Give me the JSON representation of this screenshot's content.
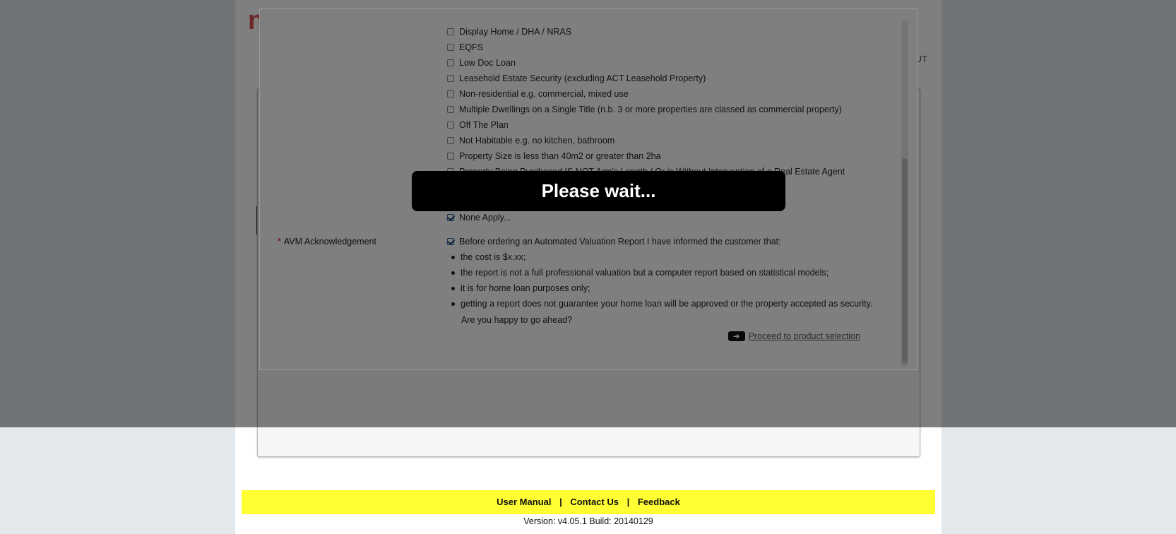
{
  "background_page": {
    "logo_fragment": "n",
    "top_right_fragment": "OUT"
  },
  "modal": {
    "options": [
      {
        "label": "Display Home / DHA / NRAS",
        "checked": false
      },
      {
        "label": "EQFS",
        "checked": false
      },
      {
        "label": "Low Doc Loan",
        "checked": false
      },
      {
        "label": "Leasehold Estate Security (excluding ACT Leasehold Property)",
        "checked": false
      },
      {
        "label": "Non-residential e.g. commercial, mixed use",
        "checked": false
      },
      {
        "label": "Multiple Dwellings on a Single Title (n.b. 3 or more properties are classed as commercial property)",
        "checked": false
      },
      {
        "label": "Off The Plan",
        "checked": false
      },
      {
        "label": "Not Habitable e.g. no kitchen, bathroom",
        "checked": false
      },
      {
        "label": "Property Size is less than 40m2 or greater than 2ha",
        "checked": false
      },
      {
        "label": "Property Being Purchased IS NOT Arm's Length / Or is Without Intervention of a Real Estate Agent",
        "checked": false
      },
      {
        "label": "None Apply...",
        "checked": true
      }
    ],
    "avm": {
      "required_marker": "*",
      "label": "AVM Acknowledgement",
      "checkbox_label": "Before ordering an Automated Valuation Report I have informed the customer that:",
      "checked": true,
      "bullets": [
        "the cost is $x.xx;",
        "the report is not a full professional valuation but a computer report based on statistical models;",
        "it is for home loan purposes only;",
        "getting a report does not guarantee your home loan will be approved or the property accepted as security."
      ],
      "question": "Are you happy to go ahead?"
    },
    "proceed_label": "Proceed to product selection",
    "proceed_icon": "arrow-right-icon"
  },
  "loading": {
    "message": "Please wait..."
  },
  "footer": {
    "links": [
      "User Manual",
      "Contact Us",
      "Feedback"
    ],
    "separator": "|",
    "version": "Version: v4.05.1 Build: 20140129",
    "bar_color": "#ffff33"
  }
}
